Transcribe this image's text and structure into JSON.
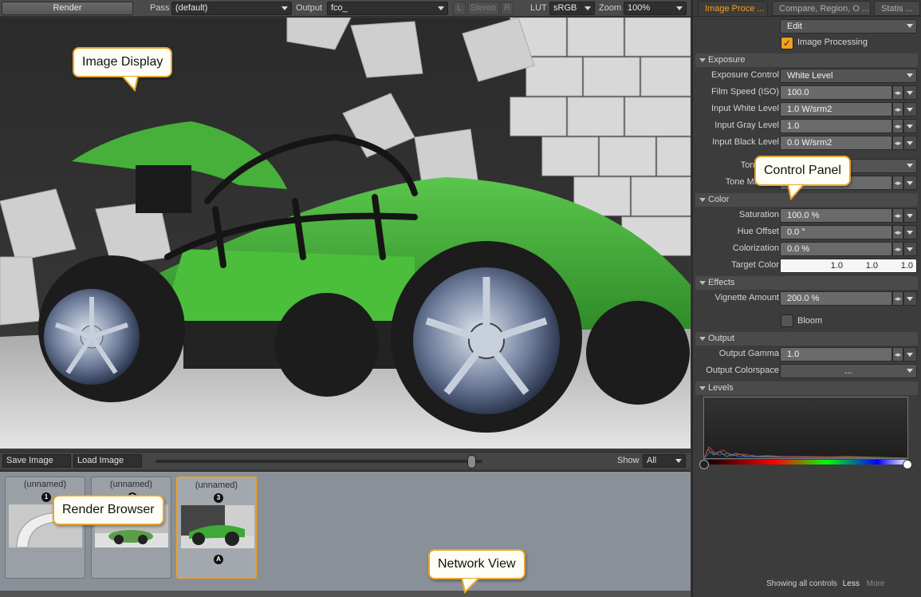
{
  "toolbar": {
    "render_label": "Render",
    "pass_label": "Pass",
    "pass_value": "(default)",
    "output_label": "Output",
    "output_value": "fco_",
    "l_label": "L",
    "stereo_label": "Stereo",
    "r_label": "R",
    "lut_label": "LUT",
    "lut_value": "sRGB",
    "zoom_label": "Zoom",
    "zoom_value": "100%"
  },
  "bottom_strip": {
    "save_label": "Save Image",
    "load_label": "Load Image",
    "show_label": "Show",
    "show_value": "All"
  },
  "render_browser": {
    "items": [
      {
        "name": "(unnamed)",
        "number": "1"
      },
      {
        "name": "(unnamed)",
        "number": "2"
      },
      {
        "name": "(unnamed)",
        "number": "3",
        "badge": "A"
      }
    ]
  },
  "panel": {
    "tabs": [
      "Image Proce ...",
      "Compare, Region, O ...",
      "Statis ..."
    ],
    "edit_value": "Edit",
    "image_processing_label": "Image Processing",
    "sections": {
      "exposure": "Exposure",
      "color": "Color",
      "effects": "Effects",
      "output": "Output",
      "levels": "Levels"
    },
    "exposure_control": {
      "label": "Exposure Control",
      "value": "White Level"
    },
    "film_speed": {
      "label": "Film Speed (ISO)",
      "value": "100.0"
    },
    "input_white": {
      "label": "Input White Level",
      "value": "1.0 W/srm2"
    },
    "input_gray": {
      "label": "Input Gray Level",
      "value": "1.0"
    },
    "input_black": {
      "label": "Input Black Level",
      "value": "0.0 W/srm2"
    },
    "tone_map": {
      "label": "Tone Map"
    },
    "tone_map_amount": {
      "label": "Tone Map Am"
    },
    "saturation": {
      "label": "Saturation",
      "value": "100.0 %"
    },
    "hue_offset": {
      "label": "Hue Offset",
      "value": "0.0 °"
    },
    "colorization": {
      "label": "Colorization",
      "value": "0.0 %"
    },
    "target_color": {
      "label": "Target Color",
      "r": "1.0",
      "g": "1.0",
      "b": "1.0"
    },
    "vignette": {
      "label": "Vignette Amount",
      "value": "200.0 %"
    },
    "bloom_label": "Bloom",
    "output_gamma": {
      "label": "Output Gamma",
      "value": "1.0"
    },
    "output_colorspace": {
      "label": "Output Colorspace",
      "value": "..."
    },
    "footer": {
      "showing": "Showing all controls",
      "less": "Less",
      "more": "More"
    }
  },
  "callouts": {
    "image_display": "Image Display",
    "control_panel": "Control Panel",
    "render_browser": "Render Browser",
    "network_view": "Network View"
  },
  "colors": {
    "accent": "#f0a020",
    "car_green": "#3fa836",
    "panel_bg": "#3c3c3c",
    "browser_bg": "#8a9098"
  }
}
